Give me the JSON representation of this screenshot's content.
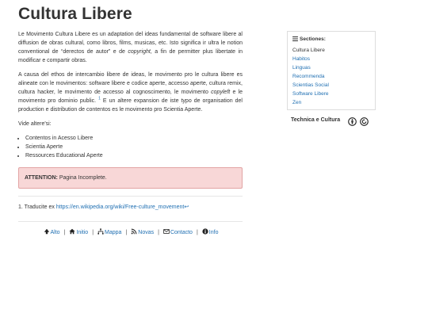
{
  "page": {
    "title": "Cultura Libere"
  },
  "content": {
    "para1": {
      "a": "Le Movimento Cultura Libere es un adaptation del ideas fundamental de software libere al diffusion de obras cultural, como libros, films, musicas, etc. Isto significa ir ultra le notion conventional de “derectos de autor” e de ",
      "em": "copyright",
      "b": ", a fin de permitter plus libertate in modificar e compartir obras."
    },
    "para2": {
      "a": "A causa del ethos de intercambio libere de ideas, le movimento pro le cultura libere es alineate con le movimentos: software libere e codice aperte, accesso aperte, cultura remix, cultura hacker, le movimento de accesso al cognoscimento, le movimento ",
      "em": "copyleft",
      "b": " e le movimento pro dominio public. ",
      "sup": "1",
      "c": " E un altere expansion de iste typo de organisation del production e distribution de contentos es le movimento pro Scientia Aperte."
    },
    "see_also": "Vide altere'si:",
    "see_also_items": [
      "Contentos in Acesso Libere",
      "Scientia Aperte",
      "Ressources Educational Aperte"
    ],
    "alert": {
      "label": "ATTENTION:",
      "text": " Pagina Incomplete."
    },
    "footnote": {
      "prefix": "1. Traducite ex ",
      "link": "https://en.wikipedia.org/wiki/Free-culture_movement",
      "return": "↩"
    }
  },
  "footer": {
    "items": [
      {
        "label": "Alto",
        "icon": "arrow-up-icon"
      },
      {
        "label": "Initio",
        "icon": "home-icon"
      },
      {
        "label": "Mappa",
        "icon": "sitemap-icon"
      },
      {
        "label": "Novas",
        "icon": "rss-icon"
      },
      {
        "label": "Contacto",
        "icon": "envelope-icon"
      },
      {
        "label": "Info",
        "icon": "info-icon"
      }
    ],
    "separator": "|"
  },
  "sidebar": {
    "heading": "Sectiones:",
    "items": [
      "Cultura Libere",
      "Habitos",
      "Linguas",
      "Recommenda",
      "Scientias Social",
      "Software Libere",
      "Zen"
    ]
  },
  "topic": {
    "label": "Technica e Cultura",
    "license_icons": [
      "cc-by-icon",
      "cc-sa-icon"
    ]
  },
  "colors": {
    "link": "#1f6fb2",
    "alert_bg": "#f8d7d7",
    "alert_border": "#e2a4a4",
    "text": "#333333"
  }
}
